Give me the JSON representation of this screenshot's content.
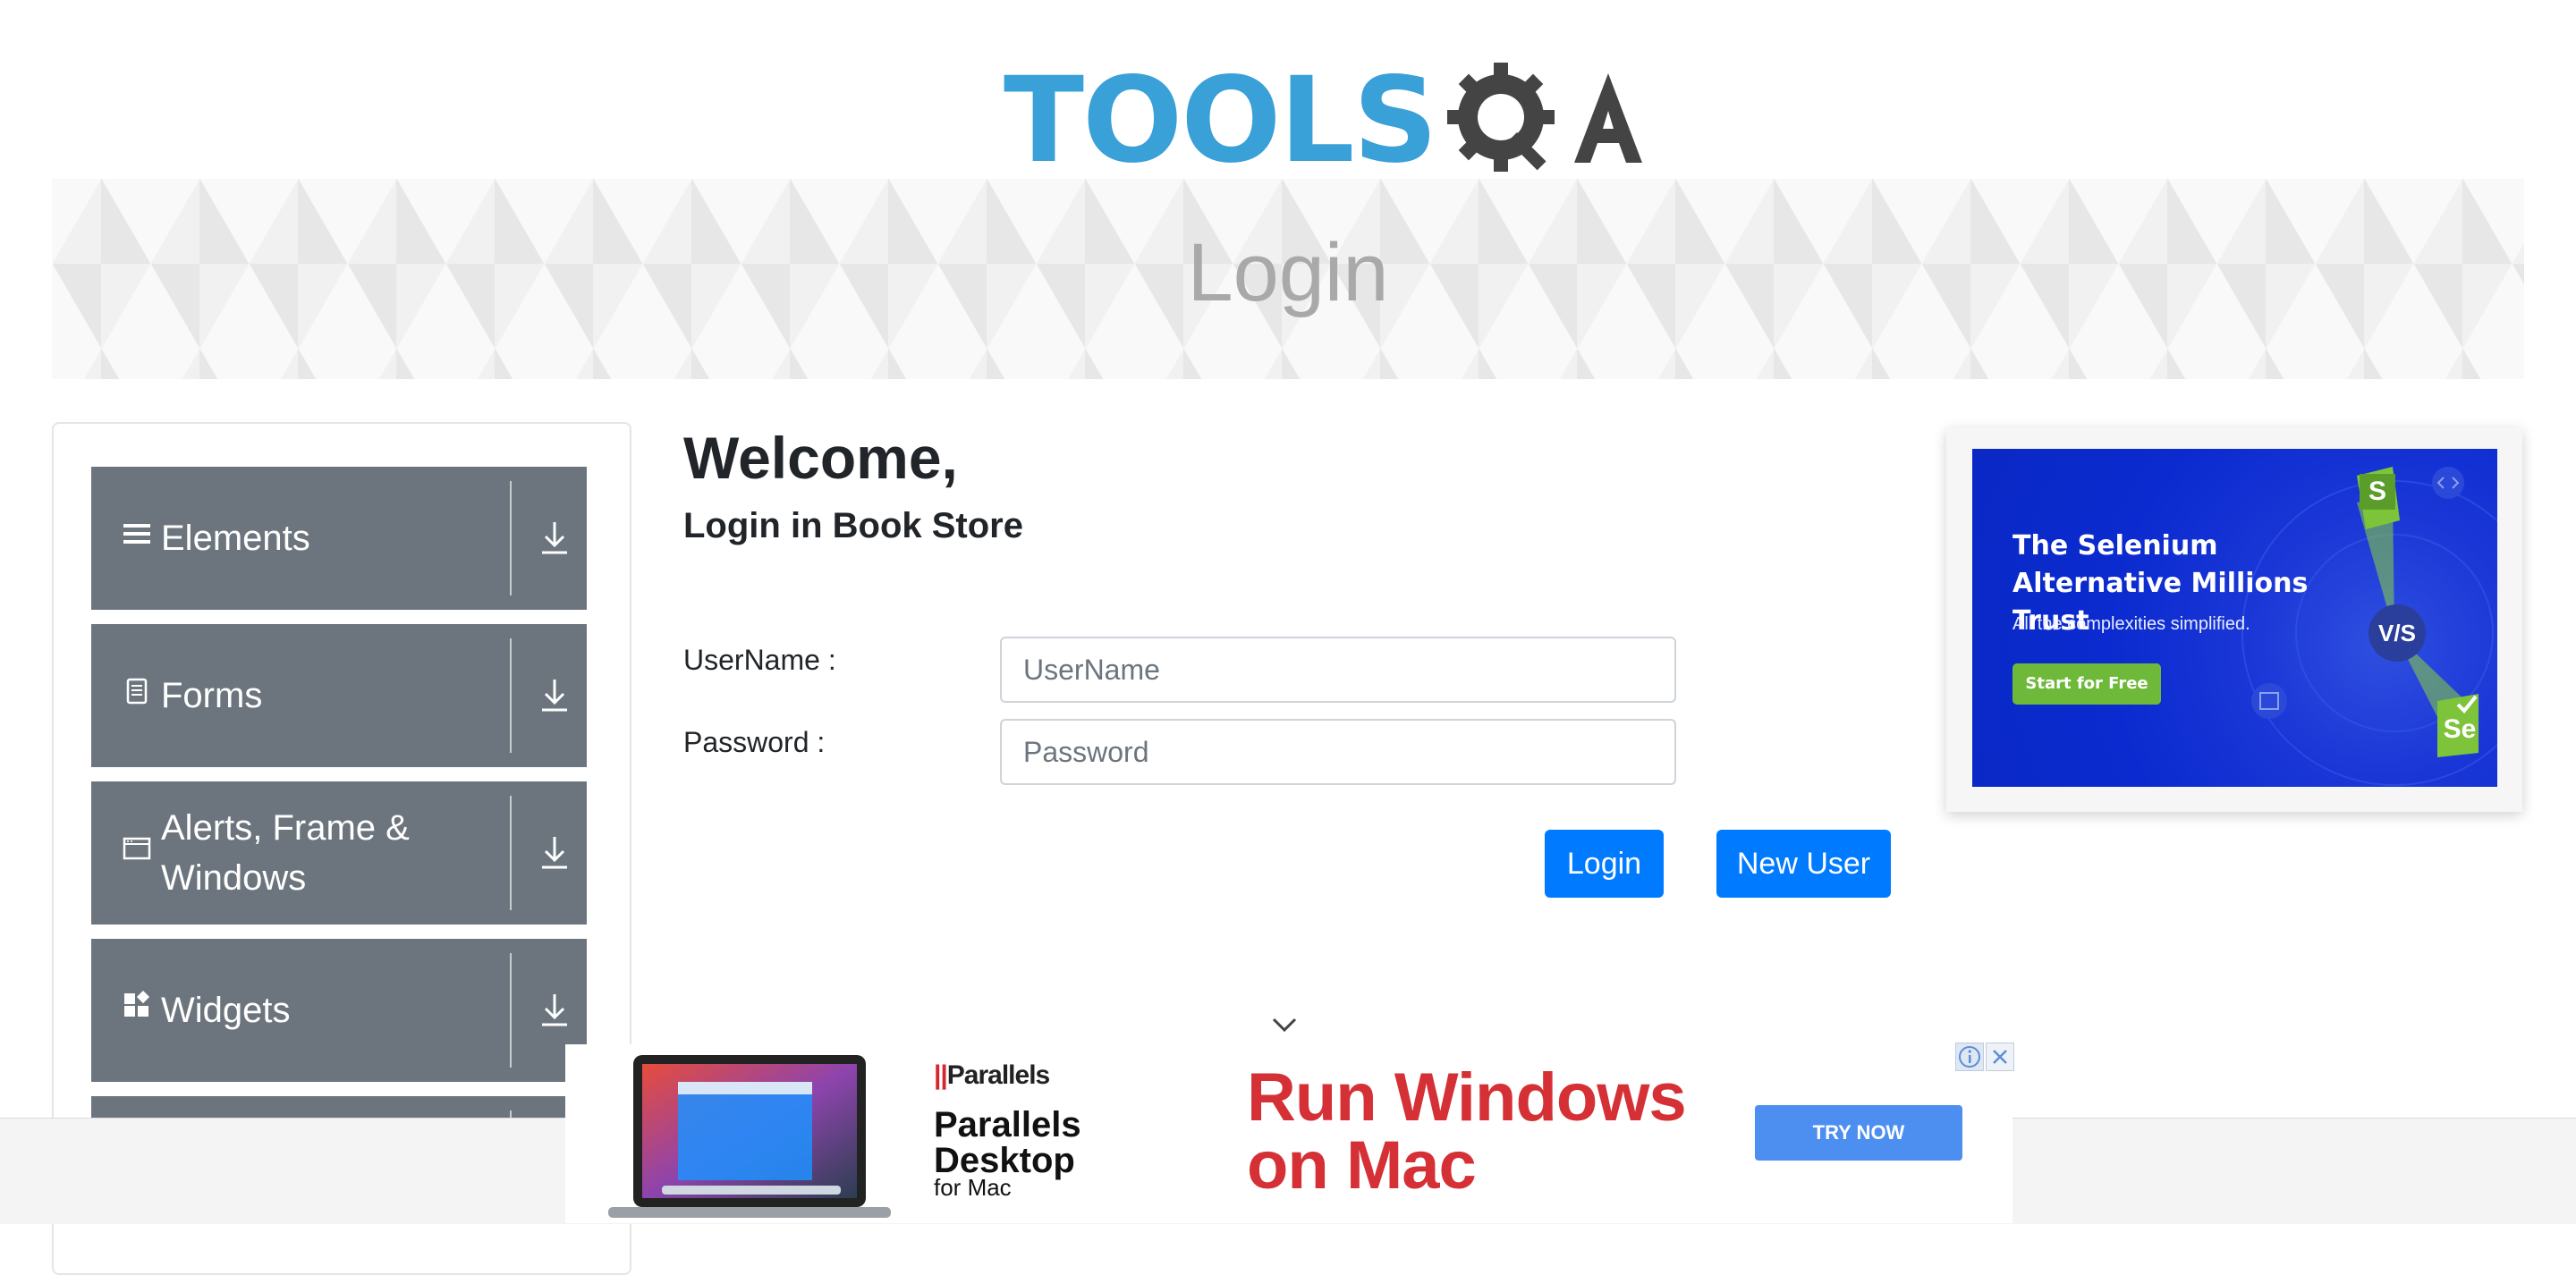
{
  "logo": {
    "text_tools": "TOOLS",
    "text_qa": "QA",
    "alt": "ToolsQA"
  },
  "banner": {
    "title": "Login"
  },
  "sidebar": {
    "items": [
      {
        "label": "Elements",
        "icon": "hamburger-icon"
      },
      {
        "label": "Forms",
        "icon": "document-icon"
      },
      {
        "label_line1": "Alerts, Frame &",
        "label_line2": "Windows",
        "icon": "window-icon"
      },
      {
        "label": "Widgets",
        "icon": "widgets-icon"
      },
      {
        "label": "",
        "icon": ""
      }
    ]
  },
  "main": {
    "welcome": "Welcome,",
    "subtitle": "Login in Book Store",
    "username_label": "UserName :",
    "username_placeholder": "UserName",
    "password_label": "Password :",
    "password_placeholder": "Password",
    "login_button": "Login",
    "new_user_button": "New User"
  },
  "ad_right": {
    "title": "The Selenium Alternative Millions Trust",
    "tagline": "All the complexities simplified.",
    "cta": "Start for Free",
    "vs": "V/S",
    "s_badge": "S",
    "se_badge": "Se",
    "colors": {
      "background": "#0a28c4",
      "cta": "#6fb93a"
    }
  },
  "ad_bottom": {
    "brand_small": "Parallels",
    "brand_big_line1": "Parallels",
    "brand_big_line2": "Desktop",
    "brand_for": "for Mac",
    "headline_line1": "Run Windows",
    "headline_line2": "on Mac",
    "cta": "TRY NOW",
    "colors": {
      "headline": "#d43035",
      "cta": "#4d8ff0"
    }
  },
  "colors": {
    "primary": "#007bff",
    "sidebar_item": "#6c757d",
    "banner_text": "#a9a9a9"
  }
}
